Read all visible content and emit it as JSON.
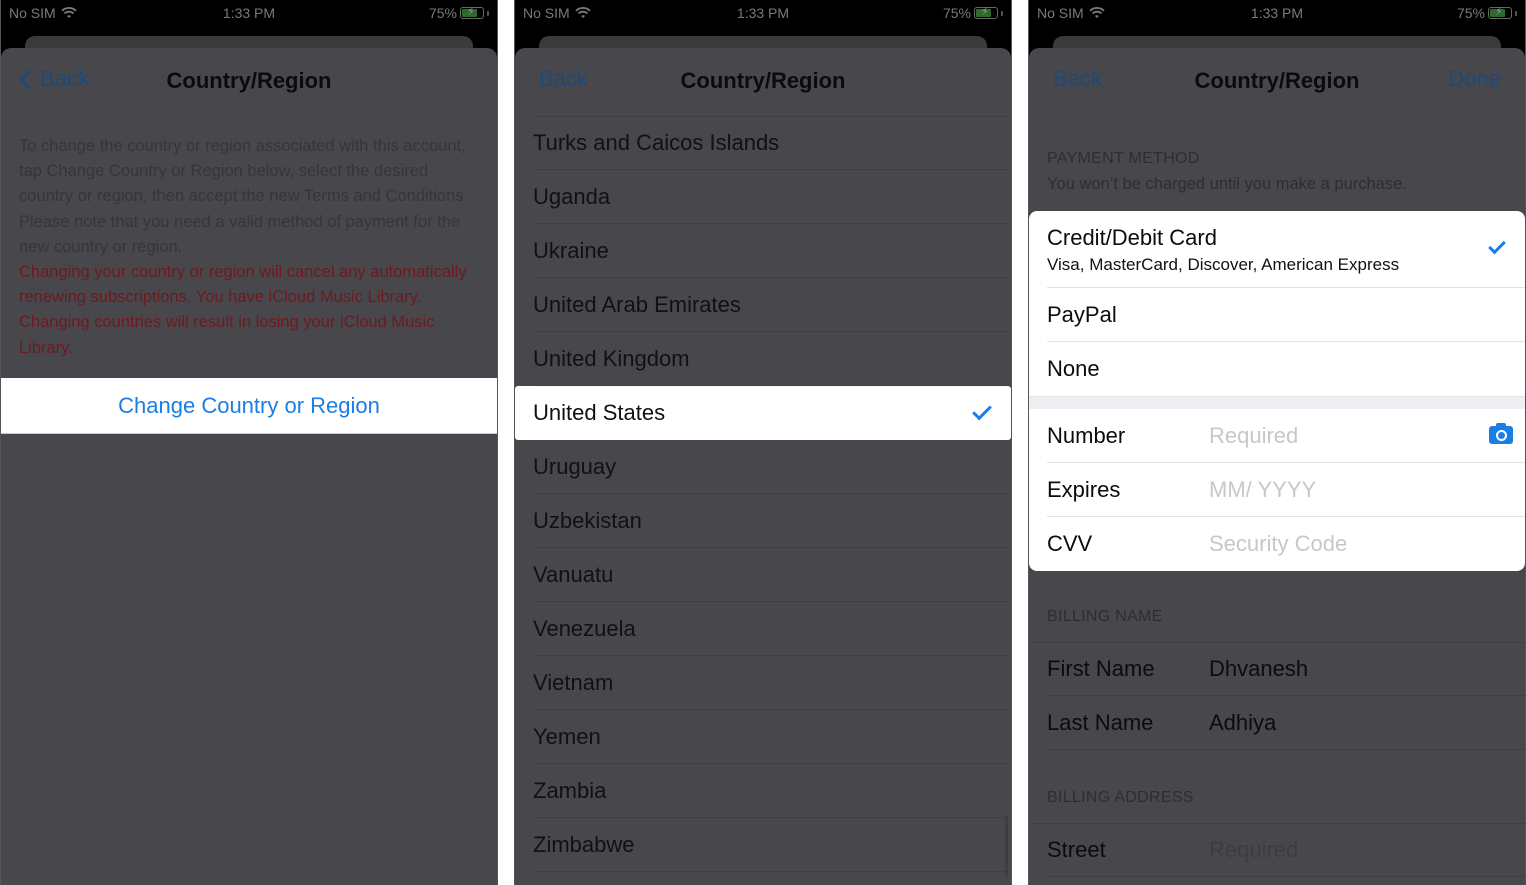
{
  "status_bar": {
    "carrier": "No SIM",
    "time": "1:33 PM",
    "battery_percent": "75%",
    "battery_level": 0.75,
    "icons": [
      "wifi-icon",
      "battery-charging-icon"
    ]
  },
  "colors": {
    "accent": "#1a7ee6",
    "warning": "#6e1a1f",
    "overlay_background": "#48474c"
  },
  "screen1": {
    "nav": {
      "back_label": "Back",
      "title": "Country/Region"
    },
    "info_text": "To change the country or region associated with this account, tap Change Country or Region below, select the desired country or region, then accept the new Terms and Conditions. Please note that you need a valid method of payment for the new country or region.",
    "warning_text": "Changing your country or region will cancel any automatically renewing subscriptions. You have iCloud Music Library. Changing countries will result in losing your iCloud Music Library.",
    "change_button_label": "Change Country or Region"
  },
  "screen2": {
    "nav": {
      "back_label": "Back",
      "title": "Country/Region"
    },
    "countries": [
      {
        "name": "Turks and Caicos Islands",
        "selected": false
      },
      {
        "name": "Uganda",
        "selected": false
      },
      {
        "name": "Ukraine",
        "selected": false
      },
      {
        "name": "United Arab Emirates",
        "selected": false
      },
      {
        "name": "United Kingdom",
        "selected": false
      },
      {
        "name": "United States",
        "selected": true
      },
      {
        "name": "Uruguay",
        "selected": false
      },
      {
        "name": "Uzbekistan",
        "selected": false
      },
      {
        "name": "Vanuatu",
        "selected": false
      },
      {
        "name": "Venezuela",
        "selected": false
      },
      {
        "name": "Vietnam",
        "selected": false
      },
      {
        "name": "Yemen",
        "selected": false
      },
      {
        "name": "Zambia",
        "selected": false
      },
      {
        "name": "Zimbabwe",
        "selected": false
      }
    ]
  },
  "screen3": {
    "nav": {
      "back_label": "Back",
      "title": "Country/Region",
      "done_label": "Done"
    },
    "payment_method": {
      "header": "PAYMENT METHOD",
      "subtitle": "You won’t be charged until you make a purchase.",
      "options": [
        {
          "title": "Credit/Debit Card",
          "subtitle": "Visa, MasterCard, Discover, American Express",
          "selected": true
        },
        {
          "title": "PayPal",
          "selected": false
        },
        {
          "title": "None",
          "selected": false
        }
      ]
    },
    "card_fields": [
      {
        "label": "Number",
        "value": "",
        "placeholder": "Required"
      },
      {
        "label": "Expires",
        "value": "",
        "placeholder": "MM/ YYYY"
      },
      {
        "label": "CVV",
        "value": "",
        "placeholder": "Security Code"
      }
    ],
    "billing_name": {
      "header": "BILLING NAME",
      "fields": [
        {
          "label": "First Name",
          "value": "Dhvanesh"
        },
        {
          "label": "Last Name",
          "value": "Adhiya"
        }
      ]
    },
    "billing_address": {
      "header": "BILLING ADDRESS",
      "fields": [
        {
          "label": "Street",
          "value": "",
          "placeholder": "Required"
        }
      ]
    }
  }
}
